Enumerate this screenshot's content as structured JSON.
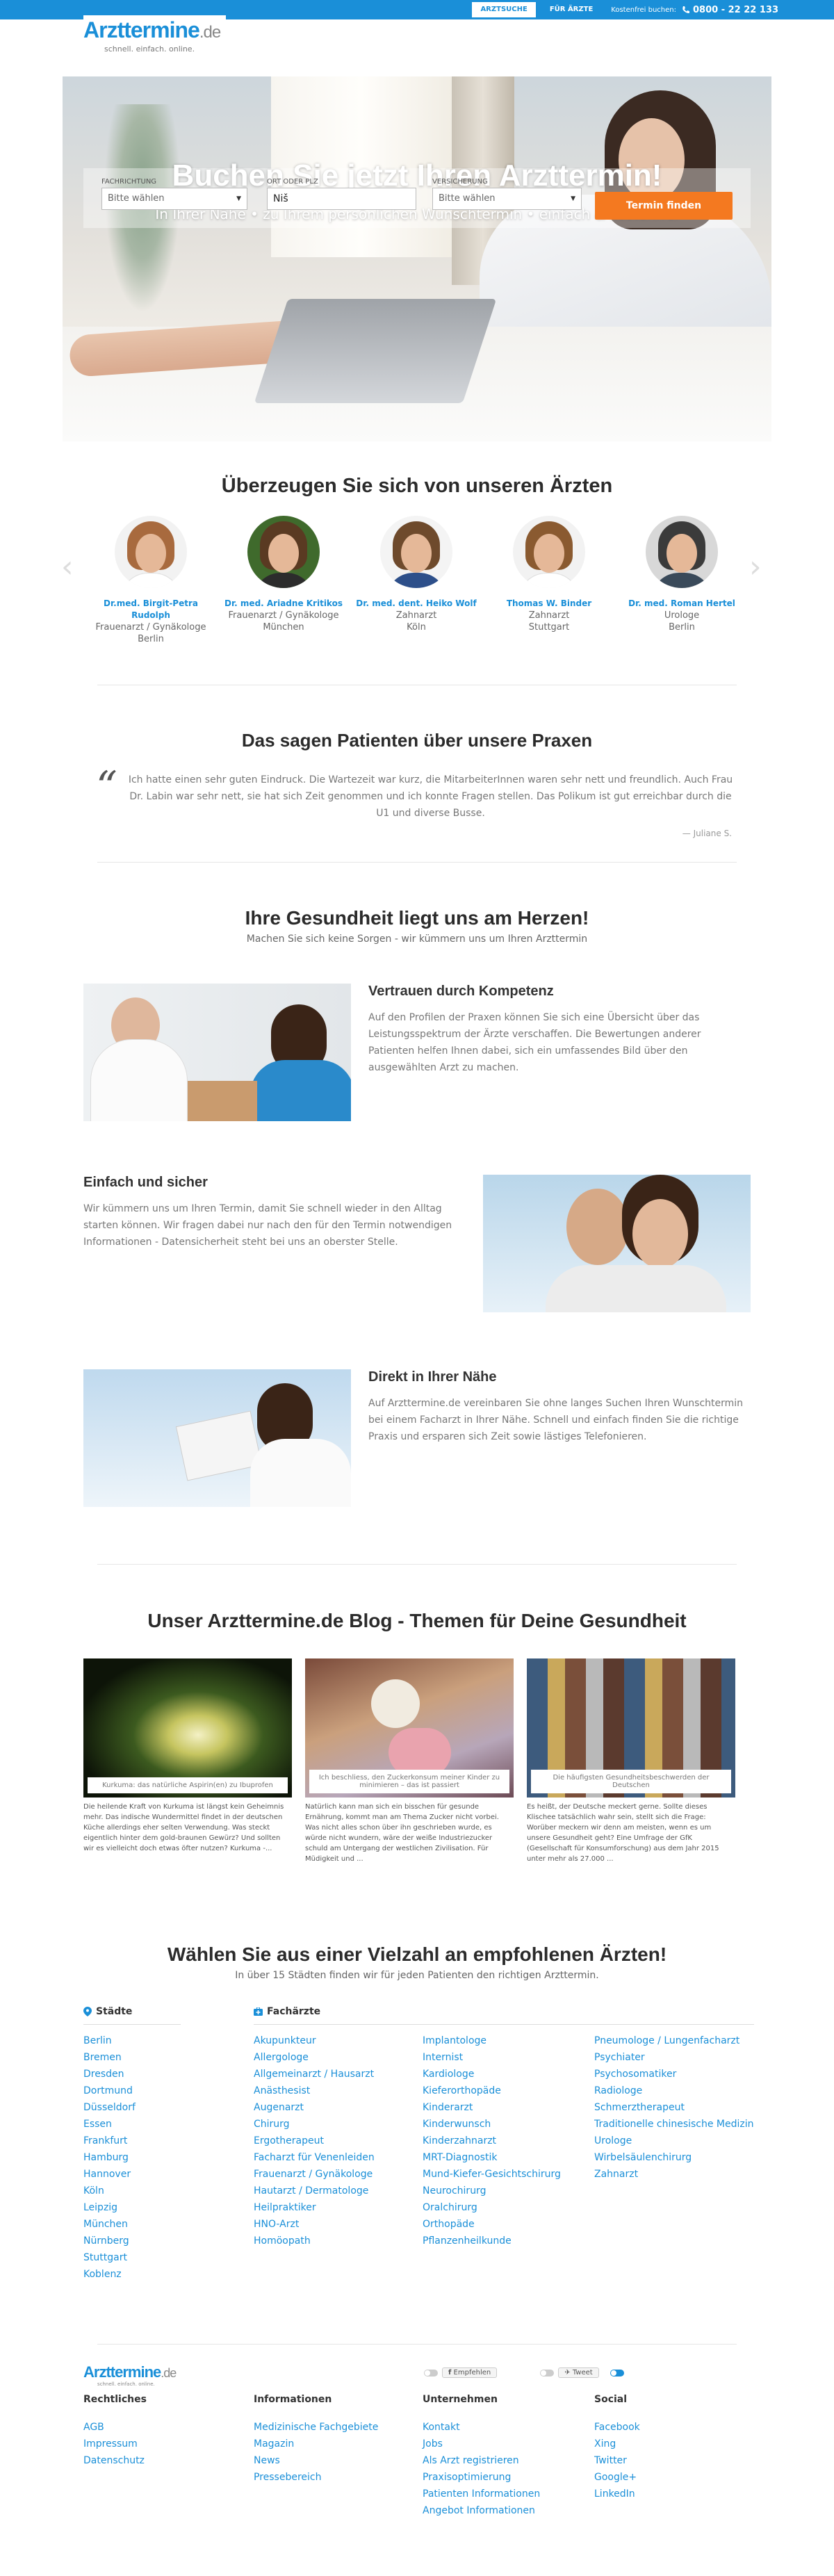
{
  "topbar": {
    "tab_search": "ARZTSUCHE",
    "tab_doctors": "FÜR ÄRZTE",
    "free_text": "Kostenfrei buchen:",
    "phone": "0800 - 22 22 133",
    "accent": "#1a8fd8"
  },
  "logo": {
    "name": "Arzttermine",
    "tld": ".de",
    "tagline": "schnell. einfach. online."
  },
  "hero": {
    "headline": "Buchen Sie jetzt Ihren Arzttermin!",
    "subline": "In Ihrer Nähe • zu Ihrem persönlichen Wunschtermin • einfach & kostenfrei",
    "specialty_label": "FACHRICHTUNG",
    "specialty_value": "Bitte wählen",
    "location_label": "ORT ODER PLZ",
    "location_value": "Niš",
    "insurance_label": "VERSICHERUNG",
    "insurance_value": "Bitte wählen",
    "submit_label": "Termin finden",
    "submit_color": "#f47920"
  },
  "doctors": {
    "title": "Überzeugen Sie sich von unseren Ärzten",
    "items": [
      {
        "name": "Dr.med. Birgit-Petra Rudolph",
        "specialty": "Frauenarzt / Gynäkologe",
        "city": "Berlin"
      },
      {
        "name": "Dr. med. Ariadne Kritikos",
        "specialty": "Frauenarzt / Gynäkologe",
        "city": "München"
      },
      {
        "name": "Dr. med. dent. Heiko Wolf",
        "specialty": "Zahnarzt",
        "city": "Köln"
      },
      {
        "name": "Thomas W. Binder",
        "specialty": "Zahnarzt",
        "city": "Stuttgart"
      },
      {
        "name": "Dr. med. Roman Hertel",
        "specialty": "Urologe",
        "city": "Berlin"
      }
    ]
  },
  "testimonial": {
    "title": "Das sagen Patienten über unsere Praxen",
    "quote": "Ich hatte einen sehr guten Eindruck. Die Wartezeit war kurz, die MitarbeiterInnen waren sehr nett und freundlich. Auch Frau Dr. Labin war sehr nett, sie hat sich Zeit genommen und ich konnte Fragen stellen. Das Polikum ist gut erreichbar durch die U1 und diverse Busse.",
    "author": "— Juliane S."
  },
  "health": {
    "title": "Ihre Gesundheit liegt uns am Herzen!",
    "subtitle": "Machen Sie sich keine Sorgen - wir kümmern uns um Ihren Arzttermin",
    "features": [
      {
        "title": "Vertrauen durch Kompetenz",
        "text": "Auf den Profilen der Praxen können Sie sich eine Übersicht über das Leistungsspektrum der Ärzte verschaffen. Die Bewertungen anderer Patienten helfen Ihnen dabei, sich ein umfassendes Bild über den ausgewählten Arzt zu machen."
      },
      {
        "title": "Einfach und sicher",
        "text": "Wir kümmern uns um Ihren Termin, damit Sie schnell wieder in den Alltag starten können. Wir fragen dabei nur nach den für den Termin notwendigen Informationen - Datensicherheit steht bei uns an oberster Stelle."
      },
      {
        "title": "Direkt in Ihrer Nähe",
        "text": "Auf Arzttermine.de vereinbaren Sie ohne langes Suchen Ihren Wunschtermin bei einem Facharzt in Ihrer Nähe. Schnell und einfach finden Sie die richtige Praxis und ersparen sich Zeit sowie lästiges Telefonieren."
      }
    ]
  },
  "blog": {
    "title": "Unser Arzttermine.de Blog - Themen für Deine Gesundheit",
    "posts": [
      {
        "caption": "Kurkuma: das natürliche Aspirin(en) zu Ibuprofen",
        "excerpt": "Die heilende Kraft von Kurkuma ist längst kein Geheimnis mehr. Das indische Wundermittel findet in der deutschen Küche allerdings eher selten Verwendung. Was steckt eigentlich hinter dem gold-braunen Gewürz? Und sollten wir es vielleicht doch etwas öfter nutzen? Kurkuma -..."
      },
      {
        "caption": "Ich beschliess, den Zuckerkonsum meiner Kinder zu minimieren – das ist passiert",
        "excerpt": "Natürlich kann man sich ein bisschen für gesunde Ernährung, kommt man am Thema Zucker nicht vorbei. Was nicht alles schon über ihn geschrieben wurde, es würde nicht wundern, wäre der weiße Industriezucker schuld am Untergang der westlichen Zivilisation. Für Müdigkeit und ..."
      },
      {
        "caption": "Die häufigsten Gesundheitsbeschwerden der Deutschen",
        "excerpt": "Es heißt, der Deutsche meckert gerne. Sollte dieses Klischee tatsächlich wahr sein, stellt sich die Frage: Worüber meckern wir denn am meisten, wenn es um unsere Gesundheit geht? Eine Umfrage der GfK (Gesellschaft für Konsumforschung) aus dem Jahr 2015 unter mehr als 27.000 ..."
      }
    ]
  },
  "choose": {
    "title": "Wählen Sie aus einer Vielzahl an empfohlenen Ärzten!",
    "subtitle": "In über 15 Städten finden wir für jeden Patienten den richtigen Arzttermin.",
    "cities_heading": "Städte",
    "specialists_heading": "Fachärzte",
    "cities": [
      "Berlin",
      "Bremen",
      "Dresden",
      "Dortmund",
      "Düsseldorf",
      "Essen",
      "Frankfurt",
      "Hamburg",
      "Hannover",
      "Köln",
      "Leipzig",
      "München",
      "Nürnberg",
      "Stuttgart",
      "Koblenz"
    ],
    "spec_col1": [
      "Akupunkteur",
      "Allergologe",
      "Allgemeinarzt / Hausarzt",
      "Anästhesist",
      "Augenarzt",
      "Chirurg",
      "Ergotherapeut",
      "Facharzt für Venenleiden",
      "Frauenarzt / Gynäkologe",
      "Hautarzt / Dermatologe",
      "Heilpraktiker",
      "HNO-Arzt",
      "Homöopath"
    ],
    "spec_col2": [
      "Implantologe",
      "Internist",
      "Kardiologe",
      "Kieferorthopäde",
      "Kinderarzt",
      "Kinderwunsch",
      "Kinderzahnarzt",
      "MRT-Diagnostik",
      "Mund-Kiefer-Gesichtschirurg",
      "Neurochirurg",
      "Oralchirurg",
      "Orthopäde",
      "Pflanzenheilkunde"
    ],
    "spec_col3": [
      "Pneumologe / Lungenfacharzt",
      "Psychiater",
      "Psychosomatiker",
      "Radiologe",
      "Schmerztherapeut",
      "Traditionelle chinesische Medizin",
      "Urologe",
      "Wirbelsäulenchirurg",
      "Zahnarzt"
    ]
  },
  "footer": {
    "logo_name": "Arzttermine",
    "logo_tld": ".de",
    "logo_tag": "schnell. einfach. online.",
    "share_label": "Empfehlen",
    "tweet_label": "Tweet",
    "columns": [
      {
        "heading": "Rechtliches",
        "links": [
          "AGB",
          "Impressum",
          "Datenschutz"
        ]
      },
      {
        "heading": "Informationen",
        "links": [
          "Medizinische Fachgebiete",
          "Magazin",
          "News",
          "Pressebereich"
        ]
      },
      {
        "heading": "Unternehmen",
        "links": [
          "Kontakt",
          "Jobs",
          "Als Arzt registrieren",
          "Praxisoptimierung",
          "Patienten Informationen",
          "Angebot Informationen"
        ]
      },
      {
        "heading": "Social",
        "links": [
          "Facebook",
          "Xing",
          "Twitter",
          "Google+",
          "LinkedIn"
        ]
      }
    ]
  }
}
